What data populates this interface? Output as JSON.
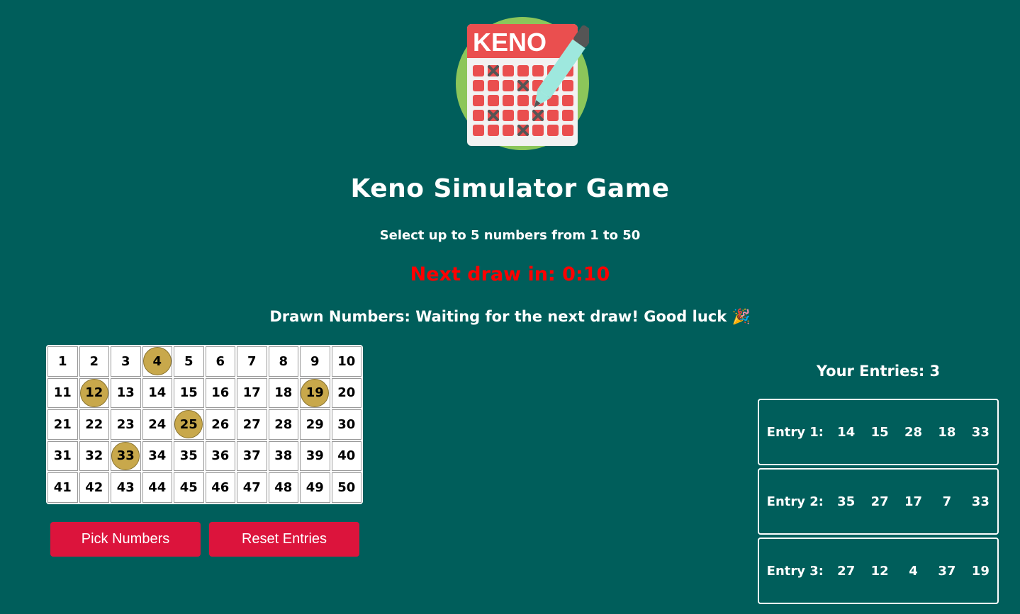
{
  "header": {
    "title": "Keno Simulator Game",
    "subtitle": "Select up to 5 numbers from 1 to 50",
    "countdown": "Next draw in: 0:10",
    "drawn_label": "Drawn Numbers:",
    "drawn_text": "Waiting for the next draw! Good luck",
    "logo_text": "KENO"
  },
  "board": {
    "numbers": [
      1,
      2,
      3,
      4,
      5,
      6,
      7,
      8,
      9,
      10,
      11,
      12,
      13,
      14,
      15,
      16,
      17,
      18,
      19,
      20,
      21,
      22,
      23,
      24,
      25,
      26,
      27,
      28,
      29,
      30,
      31,
      32,
      33,
      34,
      35,
      36,
      37,
      38,
      39,
      40,
      41,
      42,
      43,
      44,
      45,
      46,
      47,
      48,
      49,
      50
    ],
    "highlighted": [
      4,
      12,
      19,
      25,
      33
    ],
    "highlight_color": "#c8a84b"
  },
  "buttons": {
    "pick_label": "Pick Numbers",
    "reset_label": "Reset Entries",
    "color": "#dc143c"
  },
  "entries": {
    "heading": "Your Entries: 3",
    "items": [
      {
        "label": "Entry 1:",
        "numbers": [
          "14",
          "15",
          "28",
          "18",
          "33"
        ]
      },
      {
        "label": "Entry 2:",
        "numbers": [
          "35",
          "27",
          "17",
          "7",
          "33"
        ]
      },
      {
        "label": "Entry 3:",
        "numbers": [
          "27",
          "12",
          "4",
          "37",
          "19"
        ]
      }
    ]
  },
  "colors": {
    "background": "#005e5b",
    "countdown": "#ff0000"
  }
}
